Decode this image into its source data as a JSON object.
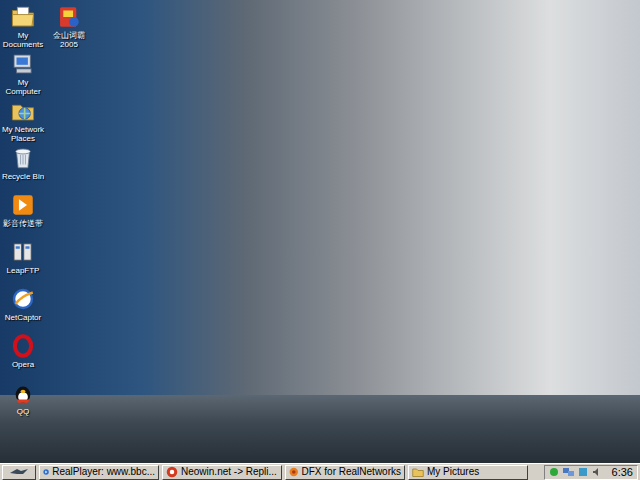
{
  "desktop": {
    "icons": [
      {
        "label": "My Documents",
        "kind": "documents"
      },
      {
        "label": "My Computer",
        "kind": "computer"
      },
      {
        "label": "My Network Places",
        "kind": "network"
      },
      {
        "label": "Recycle Bin",
        "kind": "recycle"
      },
      {
        "label": "影音传送带",
        "kind": "arrow"
      },
      {
        "label": "LeapFTP",
        "kind": "ftp"
      },
      {
        "label": "NetCaptor",
        "kind": "netcaptor"
      },
      {
        "label": "Opera",
        "kind": "opera"
      },
      {
        "label": "QQ",
        "kind": "qq"
      },
      {
        "label": "金山词霸 2005",
        "kind": "dict"
      }
    ]
  },
  "taskbar": {
    "tasks": [
      {
        "label": "RealPlayer: www.bbc...",
        "kind": "realplayer",
        "selected": false
      },
      {
        "label": "Neowin.net -> Repli...",
        "kind": "browser",
        "selected": false
      },
      {
        "label": "DFX for RealNetworks",
        "kind": "dfx",
        "selected": false
      },
      {
        "label": "My Pictures",
        "kind": "folder",
        "selected": false
      }
    ],
    "clock": "6:36"
  }
}
